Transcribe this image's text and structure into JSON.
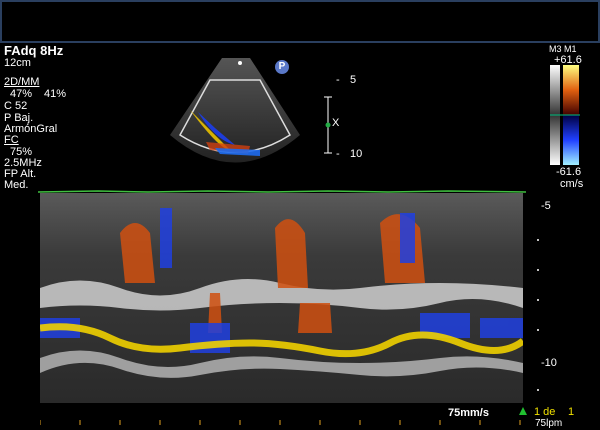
{
  "header": {
    "mode": "FAdq 8Hz",
    "depth": "12cm"
  },
  "settings": {
    "section_2d": "2D/MM",
    "gain": "47%",
    "gain2": "41%",
    "c": "C 52",
    "p": "P Baj.",
    "harmonic": "ArmónGral",
    "section_fc": "FC",
    "fc_pct": "75%",
    "freq": "2.5MHz",
    "fp": "FP Alt.",
    "med": "Med."
  },
  "depth_scale_sector": {
    "d5": "5",
    "d10": "10",
    "cursor": "X"
  },
  "p_icon": "P",
  "colorbar": {
    "labels": "M3 M1",
    "max": "+61.6",
    "min": "-61.6",
    "unit": "cm/s"
  },
  "mmode_scale": {
    "d5": "-5",
    "d10": "-10"
  },
  "footer": {
    "speed": "75mm/s",
    "frame": "1 de",
    "frame_num": "1",
    "bpm": "75lpm"
  }
}
